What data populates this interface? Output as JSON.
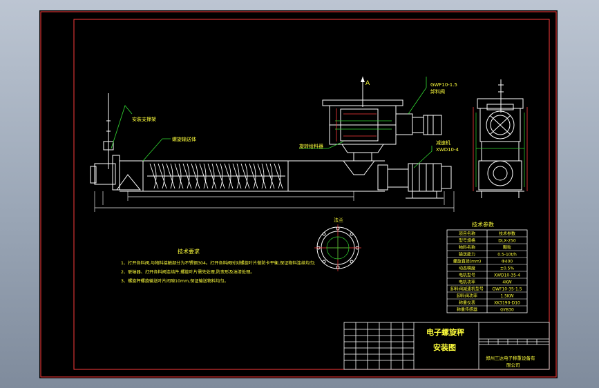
{
  "colors": {
    "frame": "#ff3b3b",
    "machine": "#ffffff",
    "leader": "#33dd33",
    "text": "#ffff3c",
    "dim": "#e8e8e8",
    "hatch": "#ffffff"
  },
  "labels": {
    "section_mark": "A",
    "discharge_valve": "卸料阀",
    "discharge_model": "GWF10-1.5",
    "reducer": "减速机",
    "reducer_model": "XWD10-4",
    "fixing_bracket": "安装支撑架",
    "screw_body": "螺旋输送体",
    "rotary_valve": "旋转给料器",
    "flange_label": "法兰"
  },
  "notes": {
    "title": "技术要求",
    "lines": [
      "1、打开各料阀,与物料接触部分为不锈钢304。打开各料阀时对螺旋叶片做防卡平衡,保证物料连续均匀;",
      "2、联轴器、打开各料阀连结件,螺旋叶片需先处理,防变形及油漆处理。",
      "3、螺旋秤螺旋输送叶片间隙10mm,保证输送物料均匀。"
    ]
  },
  "params": {
    "title": "技术参数",
    "rows": [
      [
        "项目名称",
        "技术参数"
      ],
      [
        "型号规格",
        "DLX-250"
      ],
      [
        "物料名称",
        "颗粒"
      ],
      [
        "输送能力",
        "0.5-10t/h"
      ],
      [
        "螺旋直径(mm)",
        "Φ400"
      ],
      [
        "动态精度",
        "±0.5%"
      ],
      [
        "电机型号",
        "XWD10-35-4"
      ],
      [
        "电机功率",
        "4KW"
      ],
      [
        "卸料阀减速机型号",
        "GWF10-35-1.5"
      ],
      [
        "卸料阀功率",
        "1.5KW"
      ],
      [
        "称重仪表",
        "XK3190-D10"
      ],
      [
        "称重传感器",
        "GYB30"
      ]
    ]
  },
  "title_block": {
    "name_line1": "电子螺旋秤",
    "name_line2": "安装图",
    "company_line1": "郑州三达电子称重设备有",
    "company_line2": "限公司"
  }
}
